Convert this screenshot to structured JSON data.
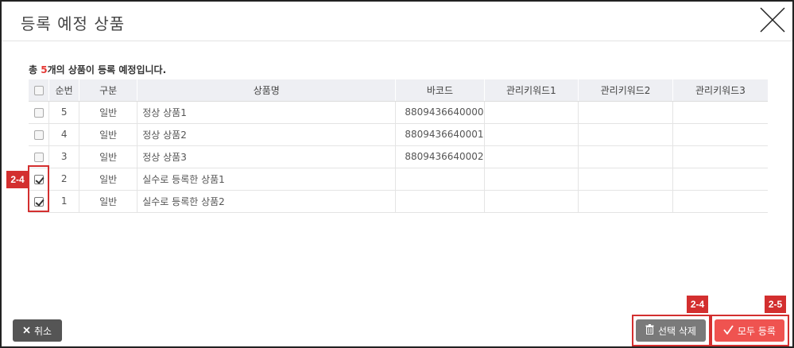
{
  "dialog": {
    "title": "등록 예정 상품"
  },
  "summary": {
    "prefix": "총 ",
    "count": "5",
    "suffix": "개의 상품이 등록 예정입니다."
  },
  "table": {
    "headers": [
      "순번",
      "구분",
      "상품명",
      "바코드",
      "관리키워드1",
      "관리키워드2",
      "관리키워드3"
    ],
    "rows": [
      {
        "checked": false,
        "no": "5",
        "type": "일반",
        "name": "정상 상품1",
        "barcode": "8809436640000",
        "kw1": "",
        "kw2": "",
        "kw3": ""
      },
      {
        "checked": false,
        "no": "4",
        "type": "일반",
        "name": "정상 상품2",
        "barcode": "8809436640001",
        "kw1": "",
        "kw2": "",
        "kw3": ""
      },
      {
        "checked": false,
        "no": "3",
        "type": "일반",
        "name": "정상 상품3",
        "barcode": "8809436640002",
        "kw1": "",
        "kw2": "",
        "kw3": ""
      },
      {
        "checked": true,
        "no": "2",
        "type": "일반",
        "name": "실수로 등록한 상품1",
        "barcode": "",
        "kw1": "",
        "kw2": "",
        "kw3": ""
      },
      {
        "checked": true,
        "no": "1",
        "type": "일반",
        "name": "실수로 등록한 상품2",
        "barcode": "",
        "kw1": "",
        "kw2": "",
        "kw3": ""
      }
    ]
  },
  "annotations": {
    "checkbox_tag": "2-4",
    "delete_tag": "2-4",
    "register_tag": "2-5"
  },
  "footer": {
    "cancel_label": "취소",
    "delete_label": "선택 삭제",
    "register_label": "모두 등록"
  },
  "colors": {
    "accent_red": "#d32f2f",
    "register_button": "#ef5350",
    "delete_button": "#7a7a7a",
    "cancel_button": "#555555",
    "header_bg": "#eeeff3"
  },
  "icons": {
    "close": "close-x-icon",
    "cancel": "x-icon",
    "delete": "trash-icon",
    "register": "checkmark-icon"
  }
}
